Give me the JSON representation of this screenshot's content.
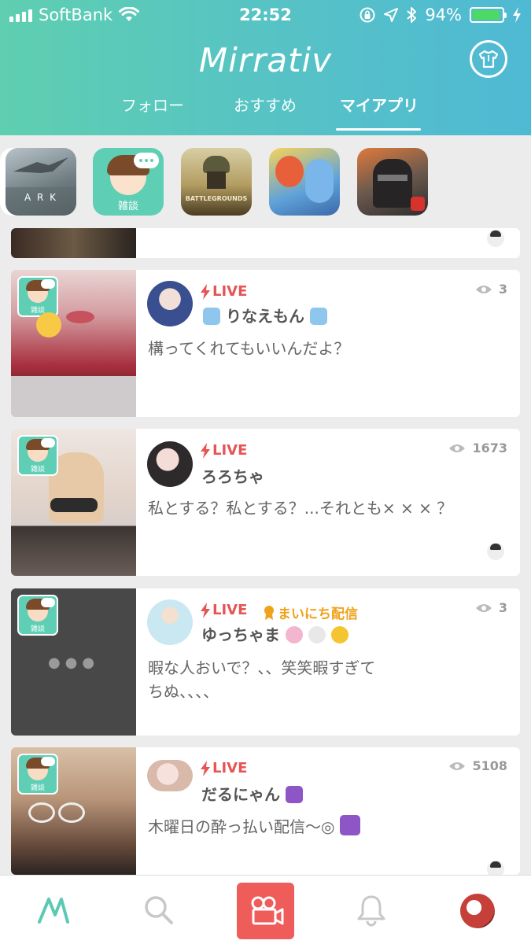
{
  "status_bar": {
    "carrier": "SoftBank",
    "time": "22:52",
    "battery": "94%",
    "battery_level": 0.94,
    "icons": [
      "signal-icon",
      "wifi-icon",
      "lock-rotation-icon",
      "location-icon",
      "bluetooth-icon",
      "battery-icon",
      "charging-icon"
    ]
  },
  "header": {
    "logo": "Mirrativ",
    "shirt_icon": "shirt-icon",
    "tabs": [
      {
        "label": "フォロー",
        "active": false
      },
      {
        "label": "おすすめ",
        "active": false
      },
      {
        "label": "マイアプリ",
        "active": true
      }
    ]
  },
  "apps": {
    "items": [
      {
        "name": "ARK",
        "label": "A R K"
      },
      {
        "name": "雑談",
        "label": "雑談"
      },
      {
        "name": "PUBG",
        "label": "BATTLEGROUNDS"
      },
      {
        "name": "monster-strike",
        "label": ""
      },
      {
        "name": "fps-game",
        "label": ""
      }
    ],
    "add_symbol": "+"
  },
  "feed": {
    "cards": [
      {
        "live_label": "LIVE",
        "daily_label": "",
        "username": "りなえもん",
        "views": "3",
        "text": "構ってくれてもいいんだよ？",
        "category": "雑談"
      },
      {
        "live_label": "LIVE",
        "daily_label": "",
        "username": "ろろちゃ",
        "views": "1673",
        "text": "私とする？私とする？...それとも× × × ？",
        "category": "雑談"
      },
      {
        "live_label": "LIVE",
        "daily_label": "まいにち配信",
        "username": "ゆっちゃま",
        "views": "3",
        "text_line1": "暇な人おいで？、、笑笑暇すぎて",
        "text_line2": "ちぬ、、、、",
        "category": "雑談"
      },
      {
        "live_label": "LIVE",
        "daily_label": "",
        "username": "だるにゃん",
        "views": "5108",
        "text": "木曜日の酔っ払い配信〜◎",
        "category": "雑談"
      }
    ]
  },
  "tabbar": {
    "items": [
      "home-icon",
      "search-icon",
      "camera-icon",
      "bell-icon",
      "profile-avatar"
    ]
  },
  "colors": {
    "brand_gradient_start": "#5fcfb0",
    "brand_gradient_end": "#4fb9d4",
    "live_red": "#e65454",
    "daily_orange": "#f0a21a",
    "camera_button": "#ef5d5a",
    "category_green": "#5ecfb5"
  }
}
